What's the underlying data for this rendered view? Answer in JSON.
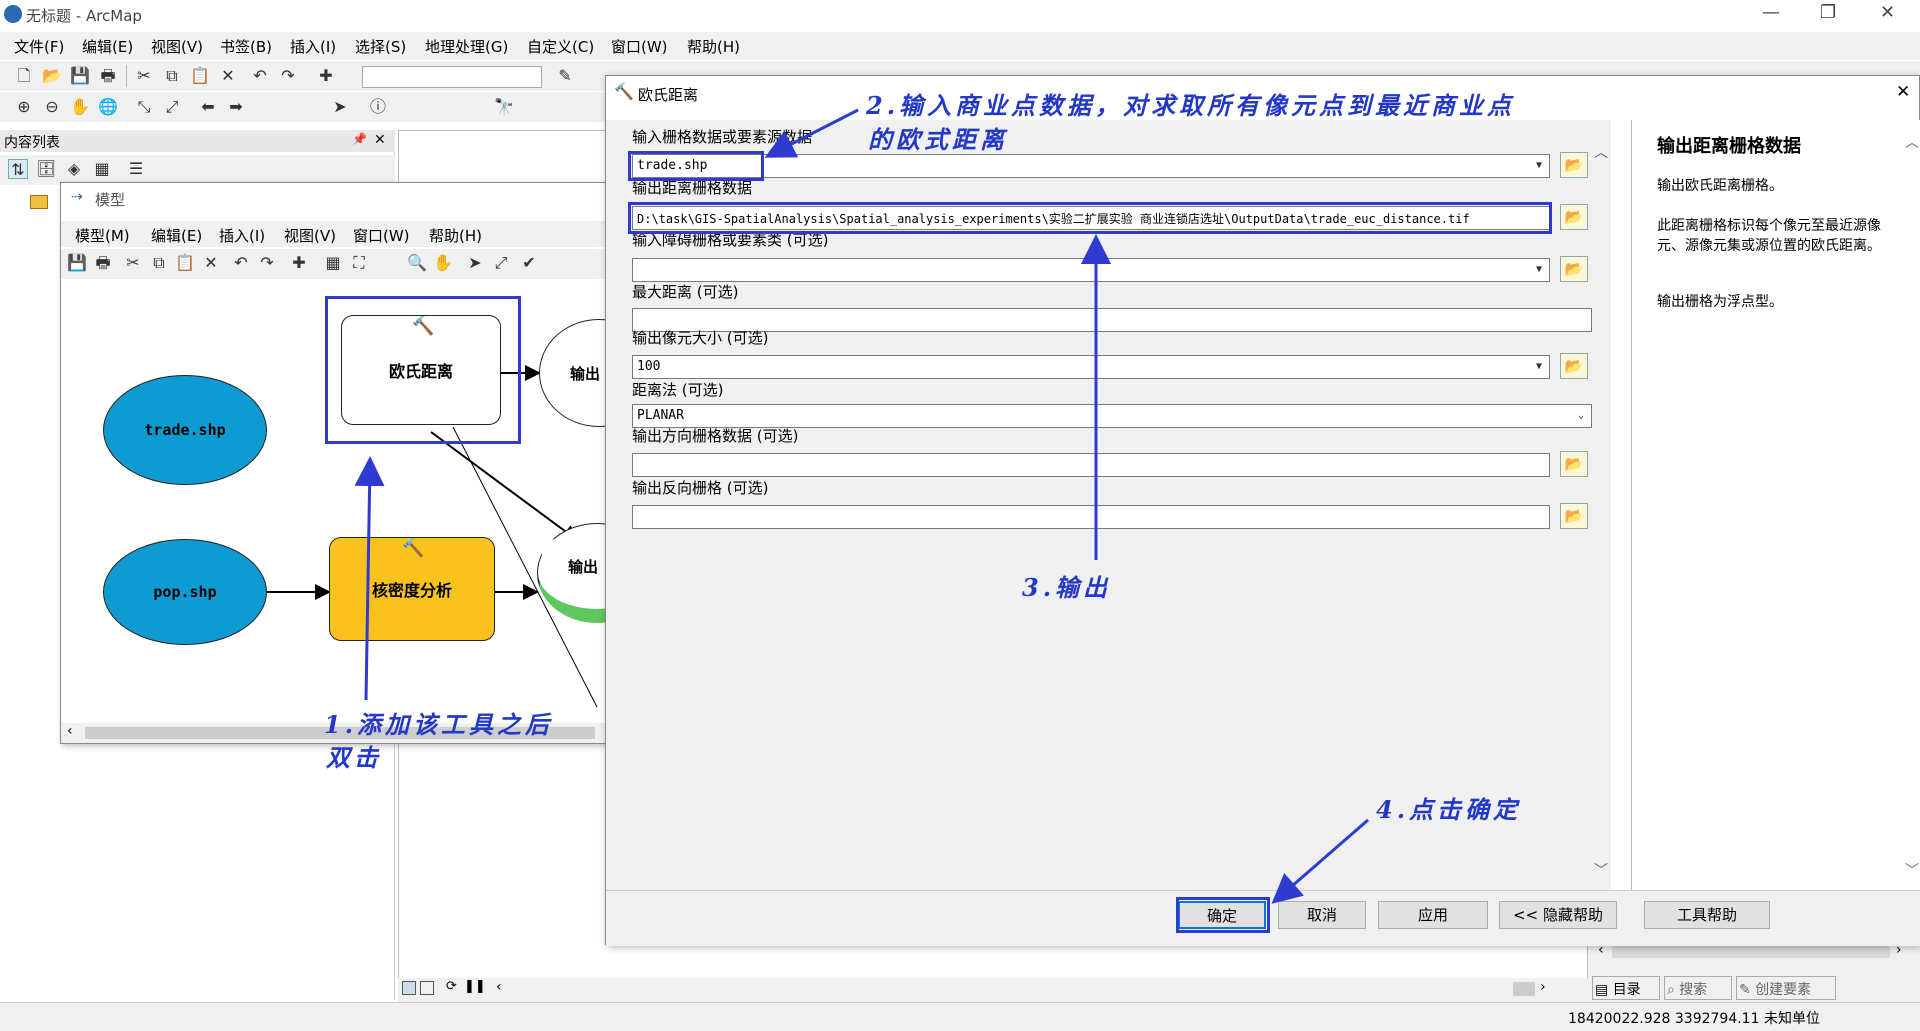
{
  "app": {
    "title": "无标题 - ArcMap",
    "min": "—",
    "restore": "❐",
    "close": "✕"
  },
  "menu": [
    "文件(F)",
    "编辑(E)",
    "视图(V)",
    "书签(B)",
    "插入(I)",
    "选择(S)",
    "地理处理(G)",
    "自定义(C)",
    "窗口(W)",
    "帮助(H)"
  ],
  "toc": {
    "title": "内容列表",
    "pin": "📌",
    "close": "✕"
  },
  "model": {
    "title": "模型",
    "menu": [
      "模型(M)",
      "编辑(E)",
      "插入(I)",
      "视图(V)",
      "窗口(W)",
      "帮助(H)"
    ],
    "nodes": {
      "trade": "trade.shp",
      "pop": "pop.shp",
      "euc": "欧氏距离",
      "kd": "核密度分析",
      "out1": "输出",
      "out2": "输出"
    }
  },
  "dialog": {
    "title": "欧氏距离",
    "close": "✕",
    "fields": [
      {
        "label": "输入栅格数据或要素源数据",
        "value": "trade.shp"
      },
      {
        "label": "输出距离栅格数据",
        "value": "D:\\task\\GIS-SpatialAnalysis\\Spatial_analysis_experiments\\实验二扩展实验 商业连锁店选址\\OutputData\\trade_euc_distance.tif"
      },
      {
        "label": "输入障碍栅格或要素类 (可选)",
        "value": ""
      },
      {
        "label": "最大距离 (可选)",
        "value": ""
      },
      {
        "label": "输出像元大小 (可选)",
        "value": "100"
      },
      {
        "label": "距离法 (可选)",
        "value": "PLANAR"
      },
      {
        "label": "输出方向栅格数据 (可选)",
        "value": ""
      },
      {
        "label": "输出反向栅格 (可选)",
        "value": ""
      }
    ],
    "help": {
      "title": "输出距离栅格数据",
      "p1": "输出欧氏距离栅格。",
      "p2": "此距离栅格标识每个像元至最近源像元、源像元集或源位置的欧氏距离。",
      "p3": "输出栅格为浮点型。"
    },
    "buttons": {
      "ok": "确定",
      "cancel": "取消",
      "apply": "应用",
      "hide_help": "<< 隐藏帮助",
      "tool_help": "工具帮助"
    }
  },
  "annotations": {
    "a1_line1": "1.添加该工具之后",
    "a1_line2": "双击",
    "a2_line1": "2.输入商业点数据，对求取所有像元点到最近商业点",
    "a2_line2": "的欧式距离",
    "a3": "3.输出",
    "a4": "4.点击确定"
  },
  "side_tabs": [
    "目录",
    "搜索",
    "创建要素"
  ],
  "status": {
    "coords": "18420022.928  3392794.11 未知单位"
  },
  "colors": {
    "ellipse": "#0e9bd2",
    "process": "#f9c21c",
    "annotation": "#2438c8"
  }
}
